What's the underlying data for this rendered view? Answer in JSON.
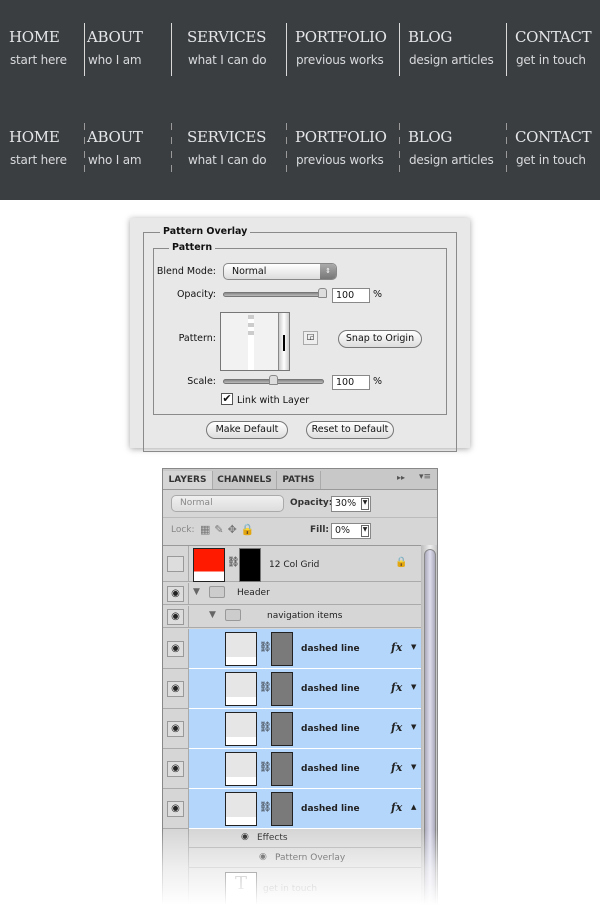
{
  "nav_rows": [
    {
      "style": "solid",
      "items": [
        {
          "title": "HOME",
          "sub": "start here"
        },
        {
          "title": "ABOUT",
          "sub": "who I am"
        },
        {
          "title": "SERVICES",
          "sub": "what I can do"
        },
        {
          "title": "PORTFOLIO",
          "sub": "previous works"
        },
        {
          "title": "BLOG",
          "sub": "design articles"
        },
        {
          "title": "CONTACT",
          "sub": "get in touch"
        }
      ]
    },
    {
      "style": "dashed",
      "items": [
        {
          "title": "HOME",
          "sub": "start here"
        },
        {
          "title": "ABOUT",
          "sub": "who I am"
        },
        {
          "title": "SERVICES",
          "sub": "what I can do"
        },
        {
          "title": "PORTFOLIO",
          "sub": "previous works"
        },
        {
          "title": "BLOG",
          "sub": "design articles"
        },
        {
          "title": "CONTACT",
          "sub": "get in touch"
        }
      ]
    }
  ],
  "dialog": {
    "group_title": "Pattern Overlay",
    "sub_title": "Pattern",
    "blend_label": "Blend Mode:",
    "blend_value": "Normal",
    "opacity_label": "Opacity:",
    "opacity_value": "100",
    "opacity_pct": 100,
    "percent": "%",
    "pattern_label": "Pattern:",
    "snap_button": "Snap to Origin",
    "scale_label": "Scale:",
    "scale_value": "100",
    "link_label": "Link with Layer",
    "link_checked": true,
    "make_default": "Make Default",
    "reset_default": "Reset to Default"
  },
  "layers": {
    "tabs": [
      "LAYERS",
      "CHANNELS",
      "PATHS"
    ],
    "blend_value": "Normal",
    "opacity_label": "Opacity:",
    "opacity_value": "30%",
    "lock_label": "Lock:",
    "fill_label": "Fill:",
    "fill_value": "0%",
    "grid_layer": "12 Col Grid",
    "grid_color": "#ff1a00",
    "header_group": "Header",
    "nav_group": "navigation items",
    "dashed_layers": [
      "dashed line",
      "dashed line",
      "dashed line",
      "dashed line",
      "dashed line"
    ],
    "fx": "fx",
    "effects": "Effects",
    "pattern_overlay": "Pattern Overlay",
    "text_layer": "get in touch",
    "selected_color": "#b5d6fb"
  }
}
